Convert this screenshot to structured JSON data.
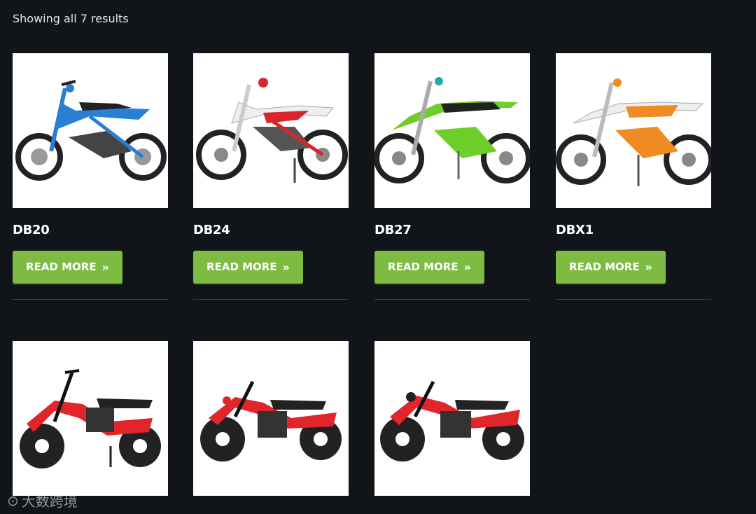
{
  "result_count": "Showing all 7 results",
  "products": [
    {
      "title": "DB20",
      "button_label": "READ MORE",
      "image": "dirt-bike-blue",
      "accent": "#2a7fd4"
    },
    {
      "title": "DB24",
      "button_label": "READ MORE",
      "image": "dirt-bike-red",
      "accent": "#d8262b"
    },
    {
      "title": "DB27",
      "button_label": "READ MORE",
      "image": "dirt-bike-green",
      "accent": "#6fcf2a"
    },
    {
      "title": "DBX1",
      "button_label": "READ MORE",
      "image": "dirt-bike-orange",
      "accent": "#f08a22"
    },
    {
      "title": "",
      "button_label": "",
      "image": "mini-bike-red",
      "accent": "#e0262a"
    },
    {
      "title": "",
      "button_label": "",
      "image": "mini-bike-red",
      "accent": "#e0262a"
    },
    {
      "title": "",
      "button_label": "",
      "image": "mini-bike-red",
      "accent": "#e0262a"
    }
  ],
  "button_icon": "double-chevron-right-icon",
  "colors": {
    "background": "#111418",
    "button": "#7dbb42",
    "divider": "#3a3e44"
  },
  "watermark": {
    "text": "大数跨境"
  }
}
